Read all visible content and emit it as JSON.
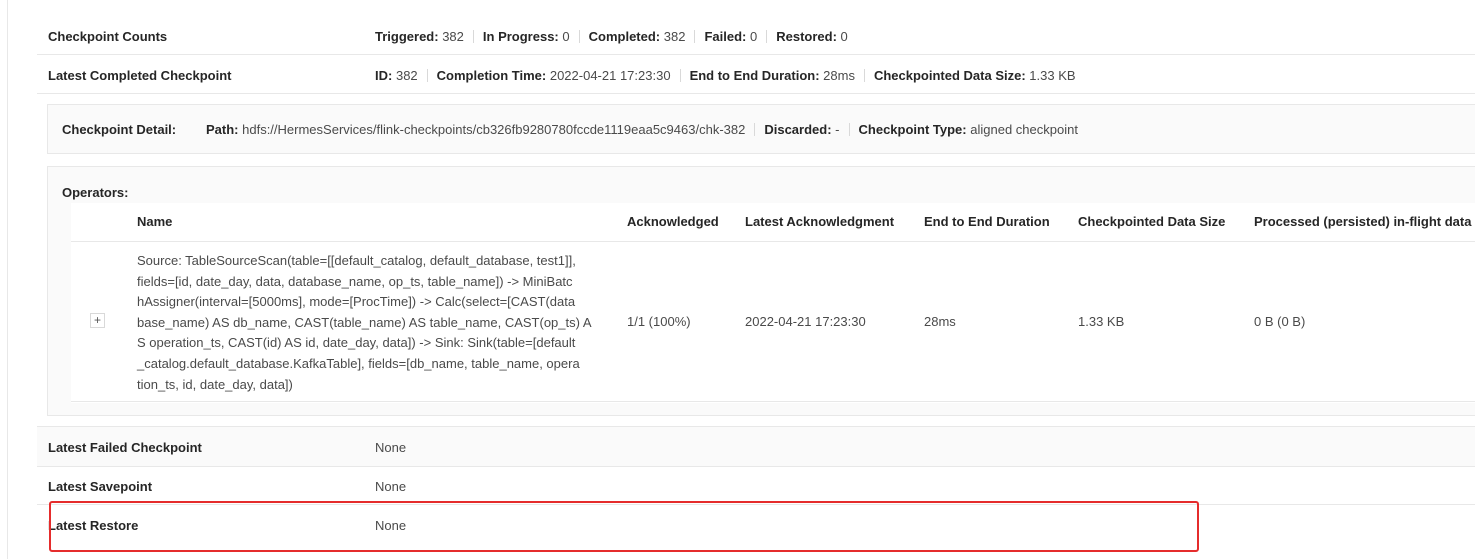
{
  "counts": {
    "label": "Checkpoint Counts",
    "items": [
      {
        "key": "Triggered:",
        "value": "382"
      },
      {
        "key": "In Progress:",
        "value": "0"
      },
      {
        "key": "Completed:",
        "value": "382"
      },
      {
        "key": "Failed:",
        "value": "0"
      },
      {
        "key": "Restored:",
        "value": "0"
      }
    ]
  },
  "latest_completed": {
    "label": "Latest Completed Checkpoint",
    "items": [
      {
        "key": "ID:",
        "value": "382"
      },
      {
        "key": "Completion Time:",
        "value": "2022-04-21 17:23:30"
      },
      {
        "key": "End to End Duration:",
        "value": "28ms"
      },
      {
        "key": "Checkpointed Data Size:",
        "value": "1.33 KB"
      }
    ]
  },
  "detail": {
    "label": "Checkpoint Detail:",
    "items": [
      {
        "key": "Path:",
        "value": "hdfs://HermesServices/flink-checkpoints/cb326fb9280780fccde1119eaa5c9463/chk-382"
      },
      {
        "key": "Discarded:",
        "value": "-"
      },
      {
        "key": "Checkpoint Type:",
        "value": "aligned checkpoint"
      }
    ]
  },
  "operators": {
    "title": "Operators:",
    "columns": [
      "Name",
      "Acknowledged",
      "Latest Acknowledgment",
      "End to End Duration",
      "Checkpointed Data Size",
      "Processed (persisted) in-flight data"
    ],
    "rows": [
      {
        "expand": "+",
        "name_lines": [
          "Source: TableSourceScan(table=[[default_catalog, default_database, test1]],",
          "fields=[id, date_day, data, database_name, op_ts, table_name]) -> MiniBatc",
          "hAssigner(interval=[5000ms], mode=[ProcTime]) -> Calc(select=[CAST(data",
          "base_name) AS db_name, CAST(table_name) AS table_name, CAST(op_ts) A",
          "S operation_ts, CAST(id) AS id, date_day, data]) -> Sink: Sink(table=[default",
          "_catalog.default_database.KafkaTable], fields=[db_name, table_name, opera",
          "tion_ts, id, date_day, data])"
        ],
        "acknowledged": "1/1 (100%)",
        "latest_ack": "2022-04-21 17:23:30",
        "duration": "28ms",
        "size": "1.33 KB",
        "inflight": "0 B (0 B)"
      }
    ]
  },
  "latest_failed": {
    "label": "Latest Failed Checkpoint",
    "value": "None"
  },
  "latest_savepoint": {
    "label": "Latest Savepoint",
    "value": "None"
  },
  "latest_restore": {
    "label": "Latest Restore",
    "value": "None"
  },
  "colors": {
    "highlight": "#e52c2c",
    "border": "#e8e8e8"
  }
}
